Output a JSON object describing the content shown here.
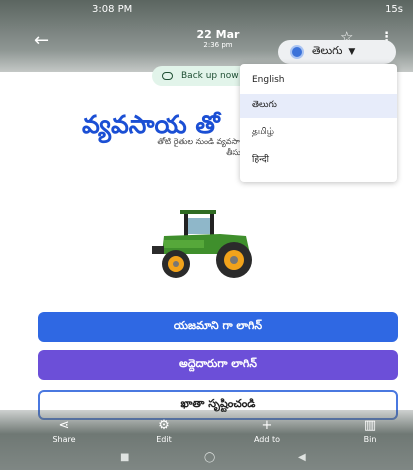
{
  "status_bar": {
    "time": "3:08 PM",
    "right": "15s"
  },
  "header": {
    "date": "22 Mar",
    "time": "2:36 pm"
  },
  "language_selector": {
    "selected": "తెలుగు",
    "icon": "globe-icon"
  },
  "backup": {
    "label": "Back up now"
  },
  "menu": {
    "items": [
      "English",
      "తెలుగు",
      "தமிழ்",
      "हिन्दी"
    ],
    "selected_index": 1
  },
  "headline": {
    "title": "వ్యవసాయ తో",
    "subtitle_line1": "తోటి రైతుల నుండి వ్యవసాయ",
    "subtitle_line2": "తీసుకోం"
  },
  "buttons": {
    "owner_login": "యజమాని గా లాగిన్",
    "renter_login": "అద్దెదారుగా లాగిన్",
    "create_account": "ఖాతా సృష్టించండి"
  },
  "toolbar": {
    "share": "Share",
    "edit": "Edit",
    "add": "Add to",
    "bin": "Bin"
  },
  "colors": {
    "primary_blue": "#2f68e3",
    "purple": "#6c4fd8",
    "headline": "#1b4fd4"
  }
}
